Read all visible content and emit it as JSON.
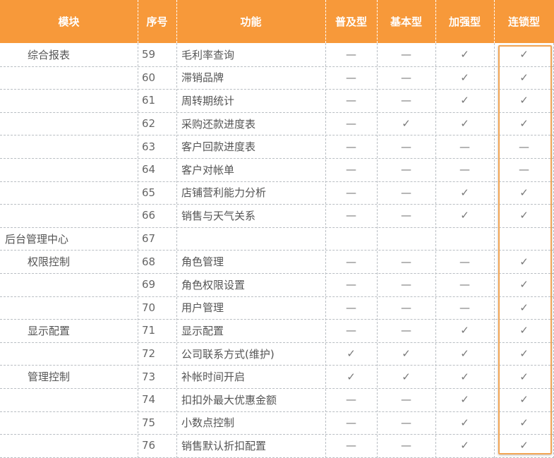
{
  "table": {
    "headers": [
      "模块",
      "序号",
      "功能",
      "普及型",
      "基本型",
      "加强型",
      "连锁型"
    ],
    "header_color": "#F7993A",
    "highlight_color": "#F2A554",
    "check_symbol": "✓",
    "dash_symbol": "—",
    "rows": [
      {
        "module": "综合报表",
        "indent": 1,
        "num": "59",
        "func": "毛利率查询",
        "marks": [
          "—",
          "—",
          "✓",
          "✓"
        ]
      },
      {
        "module": "",
        "indent": 0,
        "num": "60",
        "func": "滞销品牌",
        "marks": [
          "—",
          "—",
          "✓",
          "✓"
        ]
      },
      {
        "module": "",
        "indent": 0,
        "num": "61",
        "func": "周转期统计",
        "marks": [
          "—",
          "—",
          "✓",
          "✓"
        ]
      },
      {
        "module": "",
        "indent": 0,
        "num": "62",
        "func": "采购还款进度表",
        "marks": [
          "—",
          "✓",
          "✓",
          "✓"
        ]
      },
      {
        "module": "",
        "indent": 0,
        "num": "63",
        "func": "客户回款进度表",
        "marks": [
          "—",
          "—",
          "—",
          "—"
        ]
      },
      {
        "module": "",
        "indent": 0,
        "num": "64",
        "func": "客户对帐单",
        "marks": [
          "—",
          "—",
          "—",
          "—"
        ]
      },
      {
        "module": "",
        "indent": 0,
        "num": "65",
        "func": "店铺营利能力分析",
        "marks": [
          "—",
          "—",
          "✓",
          "✓"
        ]
      },
      {
        "module": "",
        "indent": 0,
        "num": "66",
        "func": "销售与天气关系",
        "marks": [
          "—",
          "—",
          "✓",
          "✓"
        ]
      },
      {
        "module": "后台管理中心",
        "indent": 0,
        "num": "67",
        "func": "",
        "marks": [
          "",
          "",
          "",
          ""
        ]
      },
      {
        "module": "权限控制",
        "indent": 1,
        "num": "68",
        "func": "角色管理",
        "marks": [
          "—",
          "—",
          "—",
          "✓"
        ]
      },
      {
        "module": "",
        "indent": 0,
        "num": "69",
        "func": "角色权限设置",
        "marks": [
          "—",
          "—",
          "—",
          "✓"
        ]
      },
      {
        "module": "",
        "indent": 0,
        "num": "70",
        "func": "用户管理",
        "marks": [
          "—",
          "—",
          "—",
          "✓"
        ]
      },
      {
        "module": "显示配置",
        "indent": 1,
        "num": "71",
        "func": "显示配置",
        "marks": [
          "—",
          "—",
          "✓",
          "✓"
        ]
      },
      {
        "module": "",
        "indent": 0,
        "num": "72",
        "func": "公司联系方式(维护)",
        "marks": [
          "✓",
          "✓",
          "✓",
          "✓"
        ]
      },
      {
        "module": "管理控制",
        "indent": 1,
        "num": "73",
        "func": "补帐时间开启",
        "marks": [
          "✓",
          "✓",
          "✓",
          "✓"
        ]
      },
      {
        "module": "",
        "indent": 0,
        "num": "74",
        "func": "扣扣外最大优惠金额",
        "marks": [
          "—",
          "—",
          "✓",
          "✓"
        ]
      },
      {
        "module": "",
        "indent": 0,
        "num": "75",
        "func": "小数点控制",
        "marks": [
          "—",
          "—",
          "✓",
          "✓"
        ]
      },
      {
        "module": "",
        "indent": 0,
        "num": "76",
        "func": "销售默认折扣配置",
        "marks": [
          "—",
          "—",
          "✓",
          "✓"
        ]
      }
    ]
  }
}
